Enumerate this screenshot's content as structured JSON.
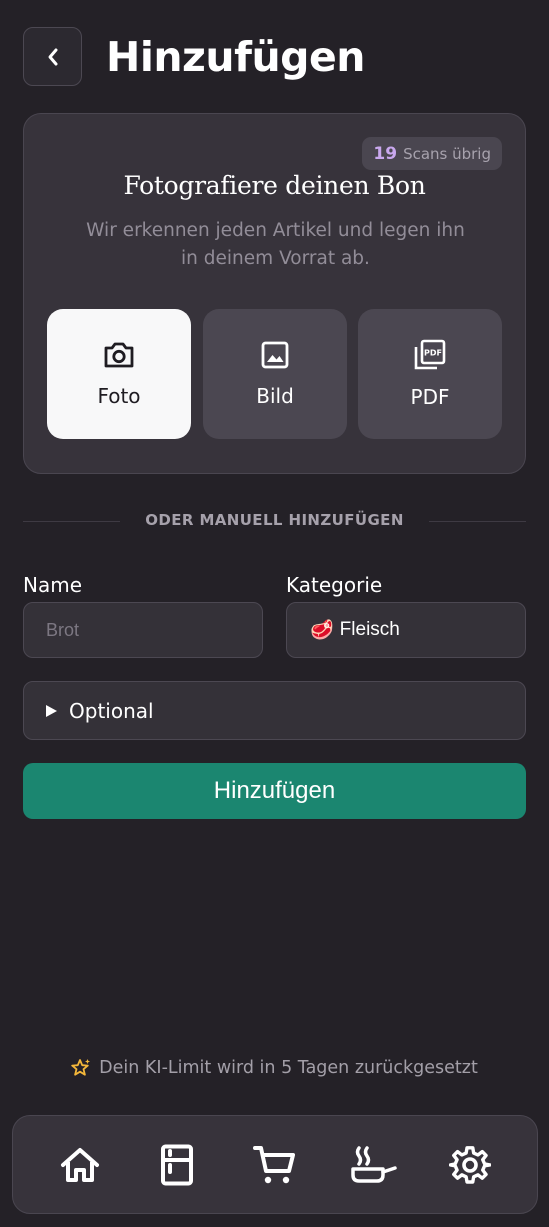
{
  "header": {
    "title": "Hinzufügen"
  },
  "scan_card": {
    "badge_count": "19",
    "badge_text": "Scans übrig",
    "title": "Fotografiere deinen Bon",
    "subtitle": "Wir erkennen jeden Artikel und legen ihn in deinem Vorrat ab.",
    "options": [
      {
        "label": "Foto",
        "icon": "camera-icon",
        "active": true
      },
      {
        "label": "Bild",
        "icon": "image-icon",
        "active": false
      },
      {
        "label": "PDF",
        "icon": "pdf-icon",
        "active": false
      }
    ]
  },
  "divider": {
    "text": "ODER MANUELL HINZUFÜGEN"
  },
  "form": {
    "name_label": "Name",
    "name_value": "",
    "name_placeholder": "Brot",
    "category_label": "Kategorie",
    "category_emoji": "🥩",
    "category_value": "Fleisch",
    "optional_label": "Optional",
    "submit_label": "Hinzufügen"
  },
  "footer": {
    "ai_limit_text": "Dein KI-Limit wird in 5 Tagen zurückgesetzt"
  },
  "nav": {
    "items": [
      "home-icon",
      "fridge-icon",
      "cart-icon",
      "cooking-pan-icon",
      "settings-gear-icon"
    ]
  },
  "colors": {
    "background": "#242127",
    "card": "#37333b",
    "accent_green": "#1b8670",
    "badge_purple": "#c9a8ee",
    "star_yellow": "#f4b73a"
  }
}
